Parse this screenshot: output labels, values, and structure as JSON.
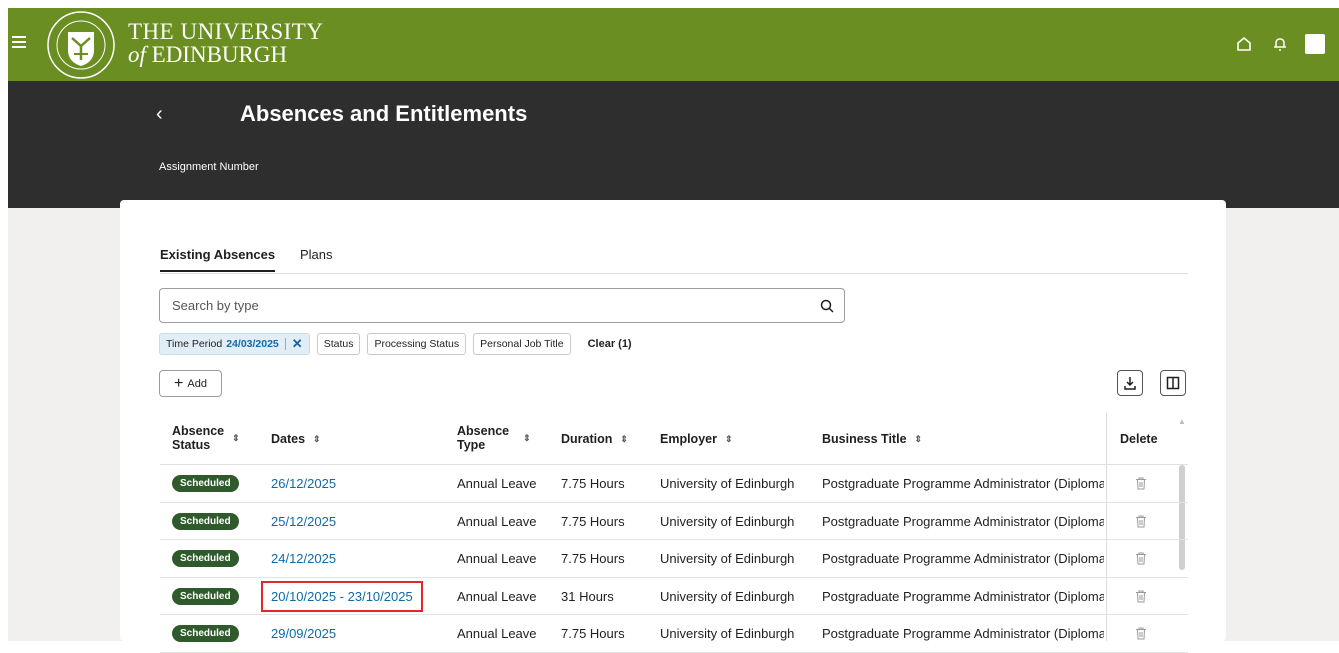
{
  "header": {
    "logo_line1": "THE UNIVERSITY",
    "logo_of": "of",
    "logo_line2": "EDINBURGH",
    "colors": {
      "brand": "#6b8e23",
      "banner": "#2e2e2e"
    }
  },
  "banner": {
    "title": "Absences and Entitlements",
    "assignment_label": "Assignment Number"
  },
  "tabs": [
    {
      "label": "Existing Absences",
      "active": true
    },
    {
      "label": "Plans",
      "active": false
    }
  ],
  "search": {
    "placeholder": "Search by type"
  },
  "filters": {
    "time_period_label": "Time Period",
    "time_period_value": "24/03/2025",
    "status": "Status",
    "processing_status": "Processing Status",
    "personal_job_title": "Personal Job Title",
    "clear": "Clear (1)"
  },
  "toolbar": {
    "add_label": "Add"
  },
  "table": {
    "headers": {
      "absence_status_1": "Absence",
      "absence_status_2": "Status",
      "dates": "Dates",
      "absence_type_1": "Absence",
      "absence_type_2": "Type",
      "duration": "Duration",
      "employer": "Employer",
      "business_title": "Business Title",
      "delete": "Delete"
    },
    "rows": [
      {
        "status": "Scheduled",
        "dates": "26/12/2025",
        "type": "Annual Leave",
        "duration": "7.75 Hours",
        "employer": "University of Edinburgh",
        "title": "Postgraduate Programme Administrator (Diploma"
      },
      {
        "status": "Scheduled",
        "dates": "25/12/2025",
        "type": "Annual Leave",
        "duration": "7.75 Hours",
        "employer": "University of Edinburgh",
        "title": "Postgraduate Programme Administrator (Diploma"
      },
      {
        "status": "Scheduled",
        "dates": "24/12/2025",
        "type": "Annual Leave",
        "duration": "7.75 Hours",
        "employer": "University of Edinburgh",
        "title": "Postgraduate Programme Administrator (Diploma"
      },
      {
        "status": "Scheduled",
        "dates": "20/10/2025 - 23/10/2025",
        "type": "Annual Leave",
        "duration": "31 Hours",
        "employer": "University of Edinburgh",
        "title": "Postgraduate Programme Administrator (Diploma",
        "highlighted": true
      },
      {
        "status": "Scheduled",
        "dates": "29/09/2025",
        "type": "Annual Leave",
        "duration": "7.75 Hours",
        "employer": "University of Edinburgh",
        "title": "Postgraduate Programme Administrator (Diploma"
      }
    ]
  }
}
